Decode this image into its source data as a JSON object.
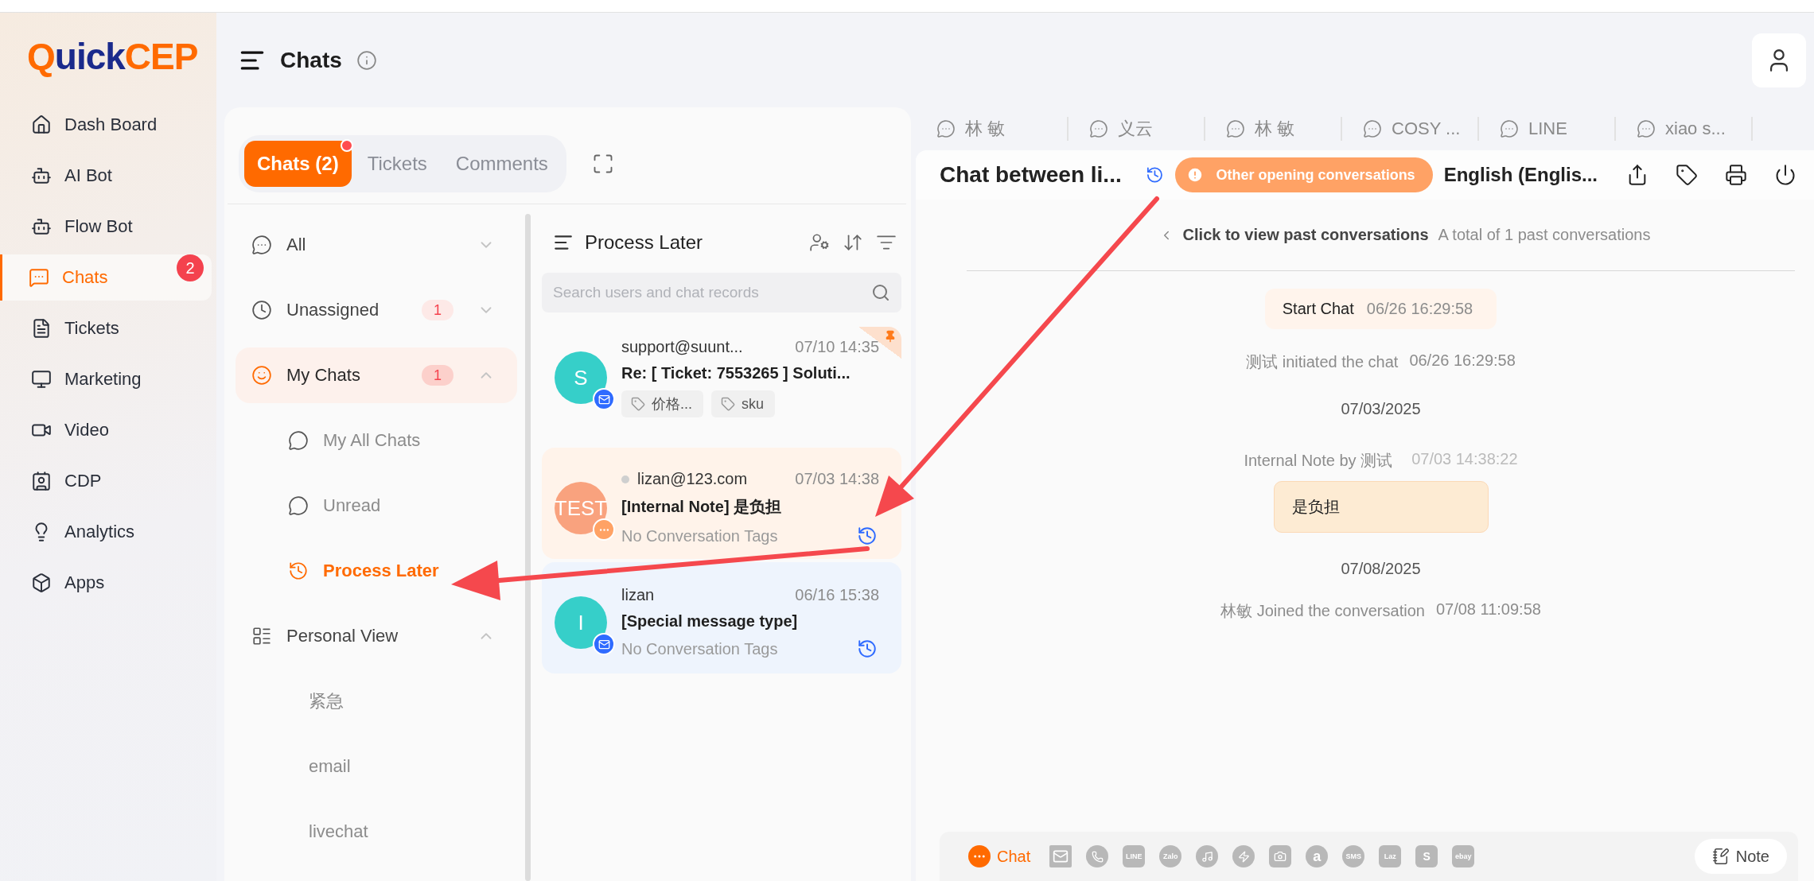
{
  "logo": [
    {
      "text": "Q",
      "color": "#ff6a00"
    },
    {
      "text": "uick",
      "color": "#1a2a8c"
    },
    {
      "text": "CEP",
      "color": "#ff6a00"
    }
  ],
  "sidebar": {
    "items": [
      {
        "label": "Dash Board",
        "selected": false
      },
      {
        "label": "AI Bot",
        "selected": false
      },
      {
        "label": "Flow Bot",
        "selected": false
      },
      {
        "label": "Chats",
        "selected": true,
        "badge": "2"
      },
      {
        "label": "Tickets",
        "selected": false
      },
      {
        "label": "Marketing",
        "selected": false
      },
      {
        "label": "Video",
        "selected": false
      },
      {
        "label": "CDP",
        "selected": false
      },
      {
        "label": "Analytics",
        "selected": false
      },
      {
        "label": "Apps",
        "selected": false
      }
    ]
  },
  "page_header": {
    "title": "Chats"
  },
  "inbox_tabs": [
    {
      "label": "Chats (2)",
      "selected": true,
      "unread_dot": true
    },
    {
      "label": "Tickets",
      "selected": false,
      "unread_dot": false
    },
    {
      "label": "Comments",
      "selected": false,
      "unread_dot": false
    }
  ],
  "views": [
    {
      "label": "All",
      "selected": false,
      "expanded": false
    },
    {
      "label": "Unassigned",
      "count": "1",
      "selected": false,
      "expanded": false
    },
    {
      "label": "My Chats",
      "count": "1",
      "selected": true,
      "expanded": true,
      "children": [
        {
          "label": "My All Chats",
          "selected": false
        },
        {
          "label": "Unread",
          "selected": false
        },
        {
          "label": "Process Later",
          "selected": true
        }
      ]
    },
    {
      "label": "Personal View",
      "selected": false,
      "expanded": true,
      "children": [
        {
          "label": "紧急",
          "selected": false
        },
        {
          "label": "email",
          "selected": false
        },
        {
          "label": "livechat",
          "selected": false
        }
      ]
    }
  ],
  "conversation_list": {
    "title": "Process Later",
    "search": {
      "placeholder": "Search users and chat records"
    },
    "conversations": [
      {
        "avatar": "S",
        "color": "#36cfc9",
        "kind": "email",
        "presence_dot": false,
        "name": "support@suunt...",
        "time": "07/10 14:35",
        "subject": "Re: [ Ticket: 7553265 ] Soluti...",
        "tags": [
          "价格...",
          "sku"
        ],
        "pinned": true,
        "process_later": false,
        "selected": false,
        "hovered": false
      },
      {
        "avatar": "TEST",
        "color": "#f9a27e",
        "kind": "chat",
        "presence_dot": true,
        "name": "lizan@123.com",
        "time": "07/03 14:38",
        "subject": "[Internal Note] 是负担",
        "empty_tags_text": "No Conversation Tags",
        "pinned": false,
        "process_later": true,
        "selected": true,
        "hovered": false
      },
      {
        "avatar": "I",
        "color": "#36cfc9",
        "kind": "email",
        "presence_dot": false,
        "name": "lizan",
        "time": "06/16 15:38",
        "subject": "[Special message type]",
        "empty_tags_text": "No Conversation Tags",
        "pinned": false,
        "process_later": true,
        "selected": false,
        "hovered": true
      }
    ]
  },
  "conversation_tabs": [
    {
      "label": "林 敏",
      "selected": false
    },
    {
      "label": "义云",
      "selected": false
    },
    {
      "label": "林 敏",
      "selected": false
    },
    {
      "label": "COSY ...",
      "selected": false
    },
    {
      "label": "LINE",
      "selected": false
    },
    {
      "label": "xiao s...",
      "selected": false
    }
  ],
  "chat_header": {
    "title": "Chat between li...",
    "process_later": true,
    "alert": "Other opening conversations",
    "language": "English (Englis..."
  },
  "history": {
    "link": "Click to view past conversations",
    "summary": "A total of 1 past conversations"
  },
  "messages": [
    {
      "kind": "event",
      "text": "Start Chat",
      "time": "06/26 16:29:58"
    },
    {
      "kind": "system",
      "text": "测试 initiated the chat",
      "time": "06/26 16:29:58"
    },
    {
      "kind": "date",
      "text": "07/03/2025"
    },
    {
      "kind": "note",
      "text": "Internal Note by 测试",
      "time": "07/03 14:38:22",
      "body": "是负担"
    },
    {
      "kind": "date",
      "text": "07/08/2025"
    },
    {
      "kind": "system",
      "text": "林敏 Joined the conversation",
      "time": "07/08 11:09:58"
    }
  ],
  "composer": {
    "channels": [
      {
        "kind": "chat",
        "label": "Chat",
        "selected": true
      },
      {
        "kind": "mail",
        "selected": false
      },
      {
        "kind": "phone",
        "selected": false
      },
      {
        "kind": "badge",
        "glyph": "LINE",
        "selected": false
      },
      {
        "kind": "bubble",
        "glyph": "Zalo",
        "selected": false
      },
      {
        "kind": "music",
        "selected": false
      },
      {
        "kind": "bolt",
        "selected": false
      },
      {
        "kind": "camera",
        "selected": false
      },
      {
        "kind": "letter",
        "glyph": "a",
        "selected": false
      },
      {
        "kind": "bubble",
        "glyph": "SMS",
        "selected": false
      },
      {
        "kind": "heart",
        "glyph": "Laz",
        "selected": false
      },
      {
        "kind": "bag",
        "glyph": "S",
        "selected": false
      },
      {
        "kind": "badge",
        "glyph": "ebay",
        "selected": false
      }
    ],
    "note_button": "Note"
  }
}
